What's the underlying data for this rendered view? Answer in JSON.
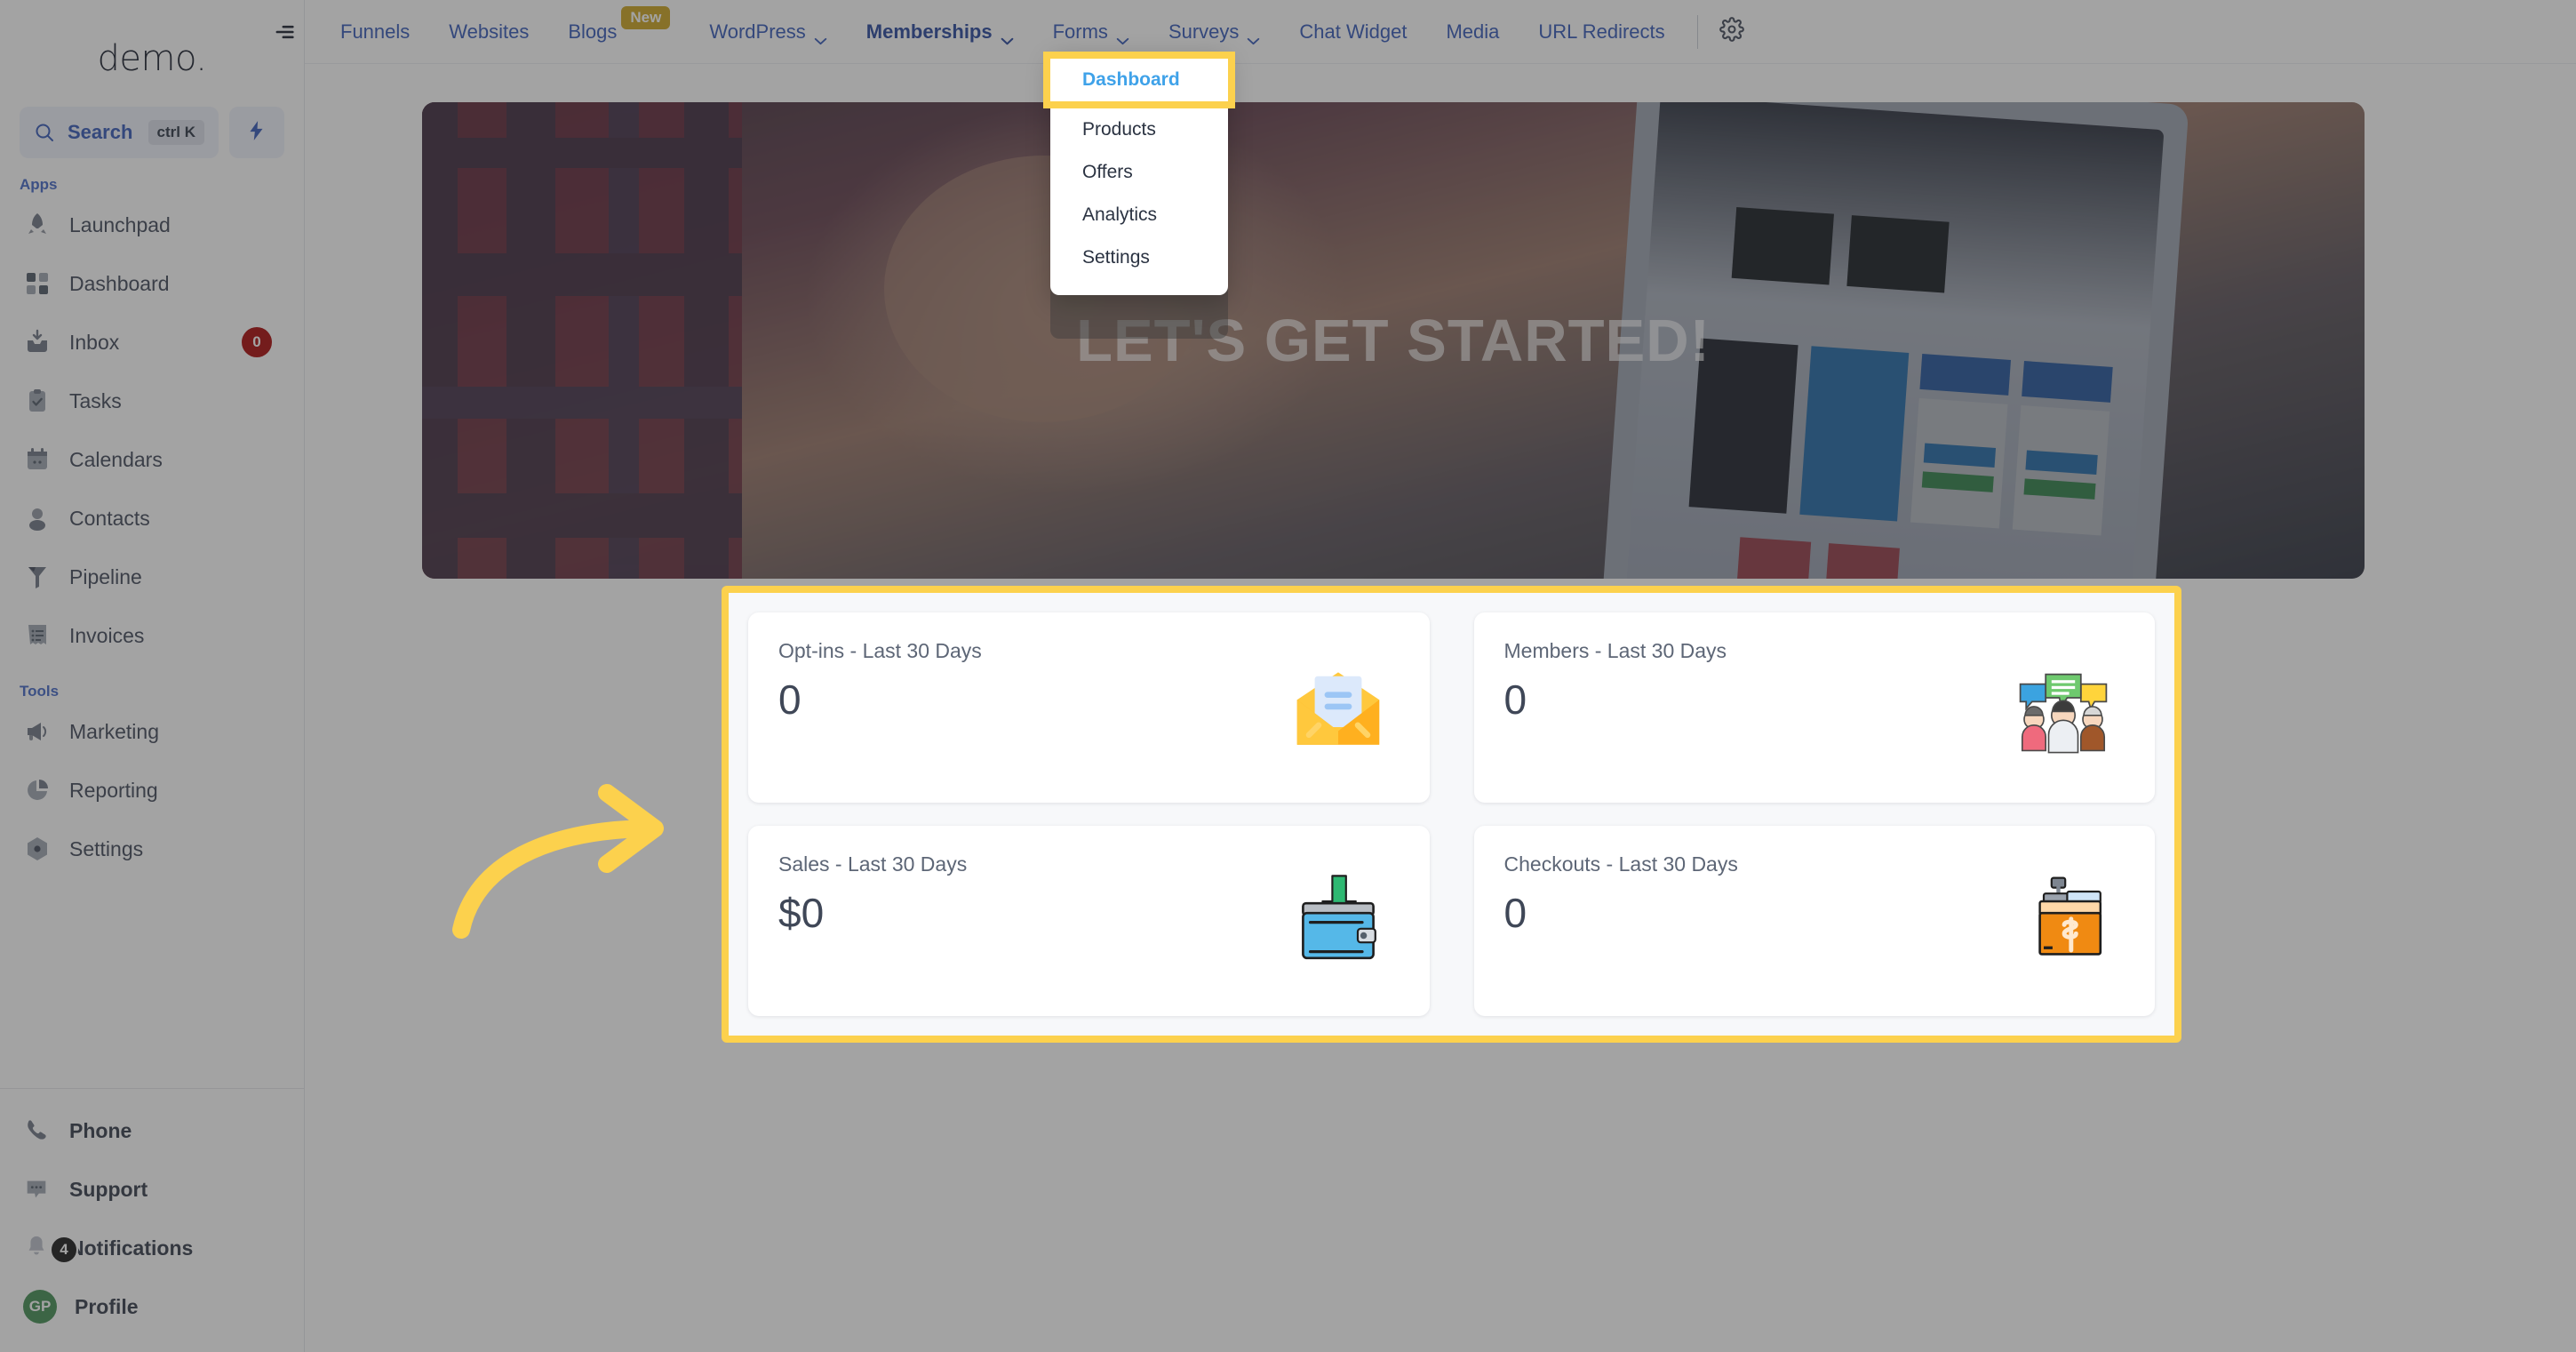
{
  "sidebar": {
    "brand": "demo.",
    "search": {
      "label": "Search",
      "shortcut": "ctrl K",
      "placeholder": "Search"
    },
    "sections": [
      {
        "label": "Apps",
        "items": [
          {
            "label": "Launchpad",
            "icon": "rocket-icon",
            "badge": null
          },
          {
            "label": "Dashboard",
            "icon": "grid-icon",
            "badge": null
          },
          {
            "label": "Inbox",
            "icon": "inbox-icon",
            "badge": "0"
          },
          {
            "label": "Tasks",
            "icon": "clipboard-check-icon",
            "badge": null
          },
          {
            "label": "Calendars",
            "icon": "calendar-icon",
            "badge": null
          },
          {
            "label": "Contacts",
            "icon": "person-icon",
            "badge": null
          },
          {
            "label": "Pipeline",
            "icon": "funnel-icon",
            "badge": null
          },
          {
            "label": "Invoices",
            "icon": "invoice-icon",
            "badge": null
          }
        ]
      },
      {
        "label": "Tools",
        "items": [
          {
            "label": "Marketing",
            "icon": "megaphone-icon",
            "badge": null
          },
          {
            "label": "Reporting",
            "icon": "pie-chart-icon",
            "badge": null
          },
          {
            "label": "Settings",
            "icon": "gear-hex-icon",
            "badge": null
          }
        ]
      }
    ],
    "bottom": [
      {
        "label": "Phone",
        "icon": "phone-icon",
        "badge": null,
        "avatar": null
      },
      {
        "label": "Support",
        "icon": "chat-dots-icon",
        "badge": null,
        "avatar": null
      },
      {
        "label": "Notifications",
        "icon": "bell-icon",
        "badge": "4",
        "avatar": null
      },
      {
        "label": "Profile",
        "icon": "avatar-icon",
        "badge": null,
        "avatar": "GP"
      }
    ]
  },
  "topnav": {
    "collapse_label": "",
    "tabs": [
      {
        "label": "Funnels",
        "caret": false,
        "badge": null,
        "active": false
      },
      {
        "label": "Websites",
        "caret": false,
        "badge": null,
        "active": false
      },
      {
        "label": "Blogs",
        "caret": false,
        "badge": "New",
        "active": false
      },
      {
        "label": "WordPress",
        "caret": true,
        "badge": null,
        "active": false
      },
      {
        "label": "Memberships",
        "caret": true,
        "badge": null,
        "active": true
      },
      {
        "label": "Forms",
        "caret": true,
        "badge": null,
        "active": false
      },
      {
        "label": "Surveys",
        "caret": true,
        "badge": null,
        "active": false
      },
      {
        "label": "Chat Widget",
        "caret": false,
        "badge": null,
        "active": false
      },
      {
        "label": "Media",
        "caret": false,
        "badge": null,
        "active": false
      },
      {
        "label": "URL Redirects",
        "caret": false,
        "badge": null,
        "active": false
      }
    ],
    "settings_icon": "gear-icon"
  },
  "dropdown": {
    "open_for": "Memberships",
    "items": [
      {
        "label": "Dashboard",
        "selected": true
      },
      {
        "label": "Products",
        "selected": false
      },
      {
        "label": "Offers",
        "selected": false
      },
      {
        "label": "Analytics",
        "selected": false
      },
      {
        "label": "Settings",
        "selected": false
      }
    ]
  },
  "hero": {
    "title": "LET'S GET STARTED!"
  },
  "stats": {
    "cards": [
      {
        "title": "Opt-ins - Last 30 Days",
        "value": "0",
        "icon": "open-envelope-icon"
      },
      {
        "title": "Members - Last 30 Days",
        "value": "0",
        "icon": "group-chat-people-icon"
      },
      {
        "title": "Sales - Last 30 Days",
        "value": "$0",
        "icon": "wallet-download-icon"
      },
      {
        "title": "Checkouts - Last 30 Days",
        "value": "0",
        "icon": "cash-register-icon"
      }
    ]
  },
  "annotations": {
    "arrow": "curved-arrow-right",
    "highlight_color": "#fcd14d",
    "accent_blue": "#2f53b5",
    "selected_blue": "#3fa2e9",
    "badge_red": "#a60000",
    "avatar_green": "#3d8b4f"
  }
}
